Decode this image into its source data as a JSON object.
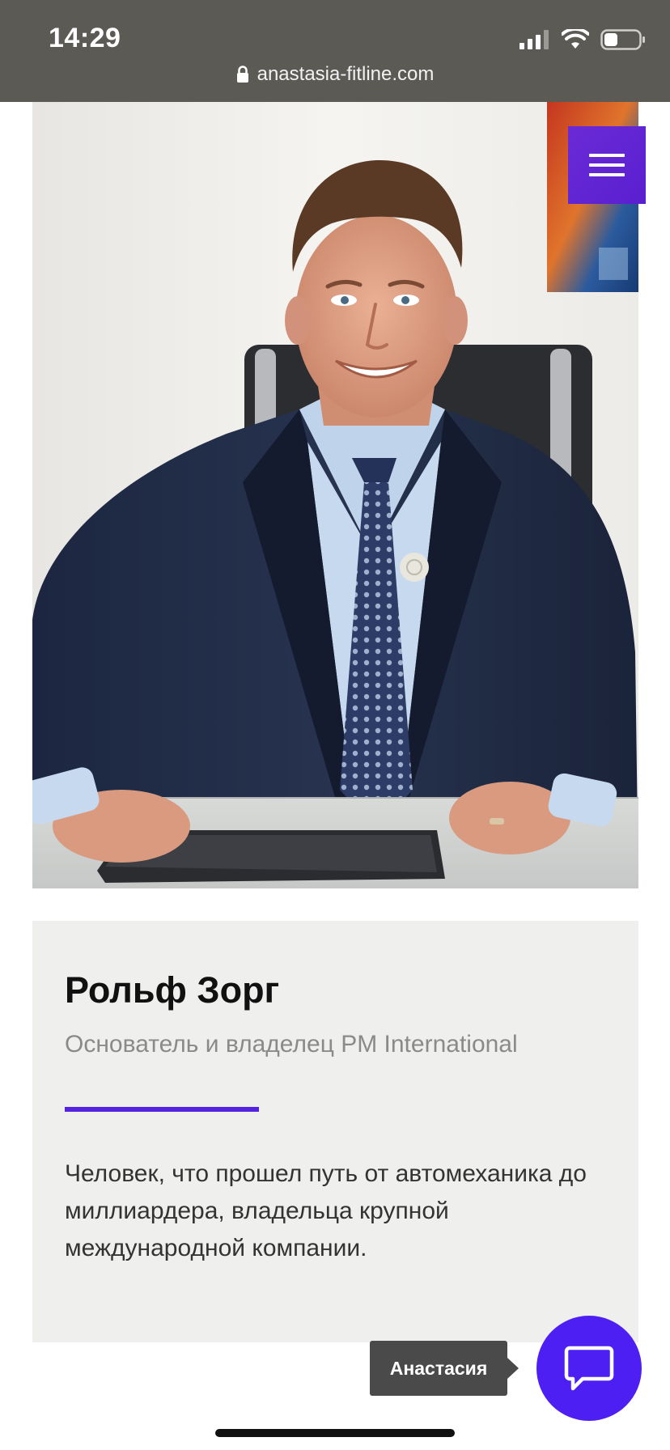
{
  "status_bar": {
    "time": "14:29",
    "url": "anastasia-fitline.com"
  },
  "icons": {
    "signal": "signal-icon",
    "wifi": "wifi-icon",
    "battery": "battery-icon",
    "lock": "lock-icon",
    "menu": "menu-icon",
    "chat": "chat-icon"
  },
  "person": {
    "name": "Рольф Зорг",
    "role": "Основатель и владелец PM International",
    "description": "Человек, что прошел путь от автомеханика до миллиардера, владельца крупной международной компании."
  },
  "chat": {
    "agent_name": "Анастасия"
  },
  "colors": {
    "accent": "#5423e2",
    "menu_button": "#5a1fd0",
    "chat_button": "#4d1ff2",
    "status_bar": "#5b5a55",
    "card_background": "#efefed"
  }
}
